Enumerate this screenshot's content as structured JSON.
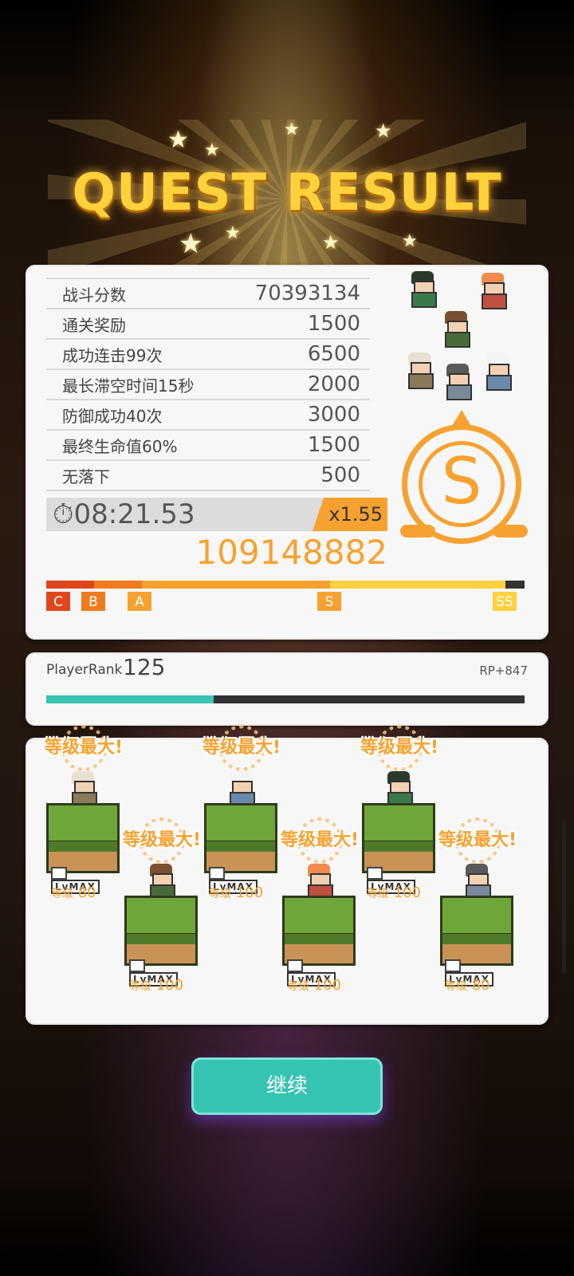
{
  "title": "QUEST RESULT",
  "score_rows": [
    {
      "label": "战斗分数",
      "value": "70393134"
    },
    {
      "label": "通关奖励",
      "value": "1500"
    },
    {
      "label": "成功连击99次",
      "value": "6500"
    },
    {
      "label": "最长滞空时间15秒",
      "value": "2000"
    },
    {
      "label": "防御成功40次",
      "value": "3000"
    },
    {
      "label": "最终生命值60%",
      "value": "1500"
    },
    {
      "label": "无落下",
      "value": "500"
    }
  ],
  "time": "⏱08:21.53",
  "multiplier": "x1.55",
  "total_score": "109148882",
  "rank_grade": "S",
  "rank_thresholds": [
    "C",
    "B",
    "A",
    "S",
    "SS"
  ],
  "player_rank": {
    "label": "PlayerRank",
    "value": "125",
    "rp": "RP+847",
    "progress": 0.35
  },
  "team": [
    {
      "max_label": "等级最大!",
      "lv_tag": "LvMAX",
      "level_prefix": "等级",
      "level": "80",
      "hair": "#e8e0d0",
      "body": "#8a7a5a"
    },
    {
      "max_label": "等级最大!",
      "lv_tag": "LvMAX",
      "level_prefix": "等级",
      "level": "100",
      "hair": "#7a5030",
      "body": "#4a6a3a"
    },
    {
      "max_label": "等级最大!",
      "lv_tag": "LvMAX",
      "level_prefix": "等级",
      "level": "100",
      "hair": "#f4f4f4",
      "body": "#6a8aaa"
    },
    {
      "max_label": "等级最大!",
      "lv_tag": "LvMAX",
      "level_prefix": "等级",
      "level": "100",
      "hair": "#f08a50",
      "body": "#c05040"
    },
    {
      "max_label": "等级最大!",
      "lv_tag": "LvMAX",
      "level_prefix": "等级",
      "level": "100",
      "hair": "#2a3a2a",
      "body": "#3a7a4a"
    },
    {
      "max_label": "等级最大!",
      "lv_tag": "LvMAX",
      "level_prefix": "等级",
      "level": "80",
      "hair": "#5a5a5a",
      "body": "#7a8a9a"
    }
  ],
  "continue_label": "继续",
  "colors": {
    "accent": "#f7a230",
    "teal": "#36c4b2",
    "card": "#f7f7f7"
  }
}
